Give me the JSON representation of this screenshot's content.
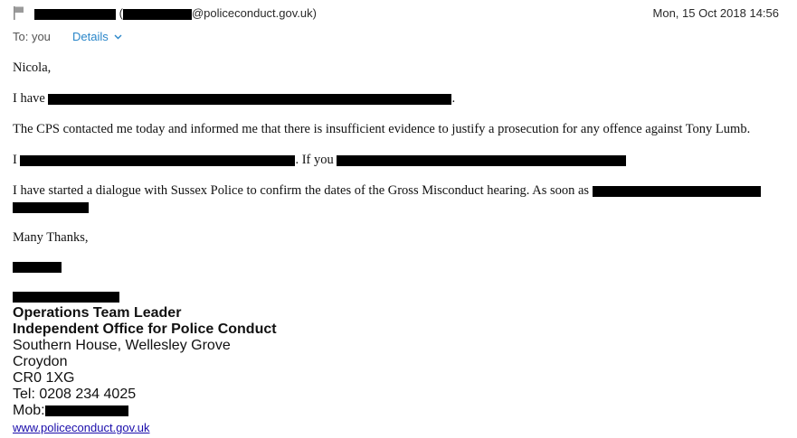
{
  "header": {
    "sender_email_suffix": "@policeconduct.gov.uk)",
    "sender_paren_open": "(",
    "date": "Mon, 15 Oct 2018 14:56",
    "to_label": "To: you",
    "details_label": "Details",
    "icons": {
      "flag": "flag-icon",
      "details": "chevron-down-icon"
    }
  },
  "body": {
    "greeting": "Nicola,",
    "p1_start": "I have",
    "p1_end": ".",
    "p2": "The CPS contacted me today and informed me that there is insufficient evidence to justify a prosecution for any offence against Tony Lumb.",
    "p3_start": "I",
    "p3_mid": ". If you",
    "p4": "I have started a dialogue with Sussex Police to confirm the dates of the Gross Misconduct hearing. As soon as",
    "closing": "Many Thanks,"
  },
  "signature": {
    "title": "Operations Team Leader",
    "org": "Independent Office for Police Conduct",
    "address1": "Southern House, Wellesley Grove",
    "city": "Croydon",
    "postcode": "CR0 1XG",
    "tel": "Tel: 0208 234 4025",
    "mob_label": "Mob:",
    "website": "www.policeconduct.gov.uk"
  },
  "colors": {
    "link": "#2a86c9",
    "redaction": "#000000"
  }
}
